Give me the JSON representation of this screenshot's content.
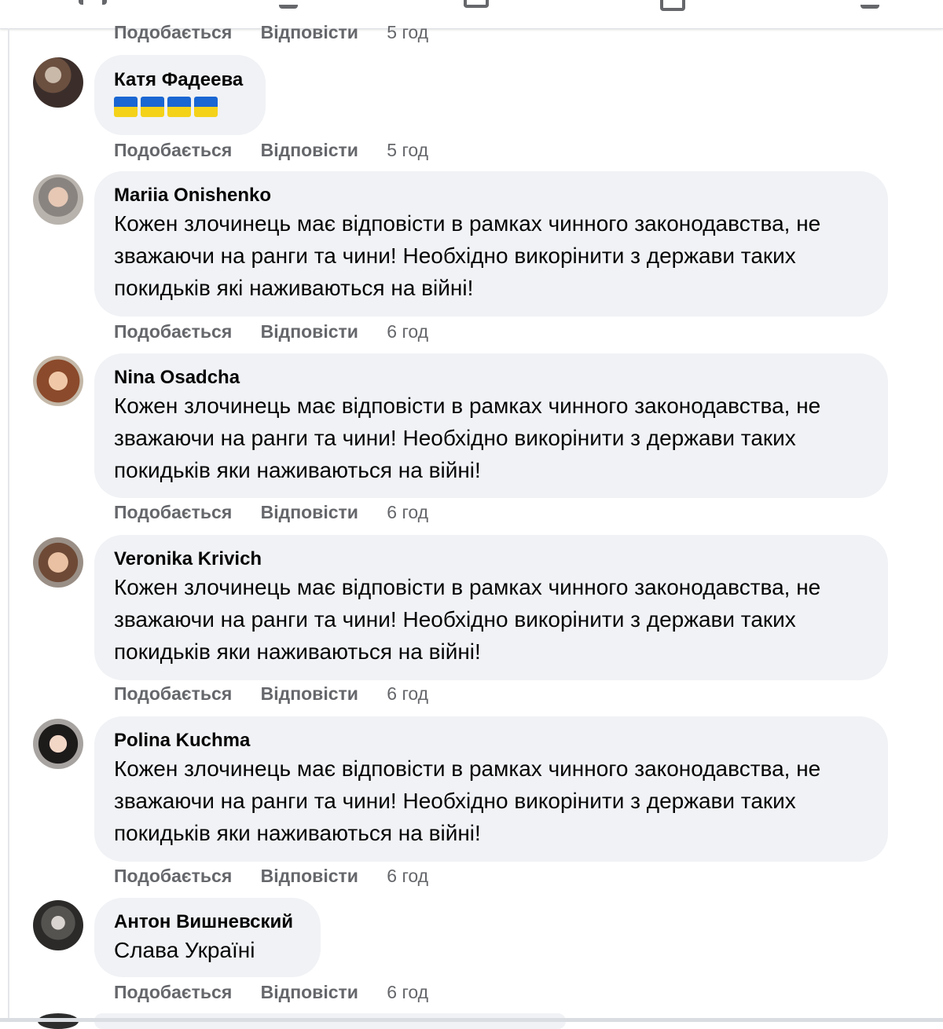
{
  "top_actions": {
    "like": "Подобається",
    "reply": "Відповісти",
    "time": "5 год"
  },
  "colors": {
    "flag_blue": "#1a66d2",
    "flag_yellow": "#f4d21a"
  },
  "comments": [
    {
      "author": "Катя Фадеева",
      "text": "",
      "flags": [
        "ukraine-flag-icon",
        "ukraine-flag-icon",
        "ukraine-flag-icon",
        "ukraine-flag-icon"
      ],
      "like": "Подобається",
      "reply": "Відповісти",
      "time": "5 год",
      "avatar": "avatar-photo"
    },
    {
      "author": "Mariia Onishenko",
      "text": "Кожен злочинець має відповісти в рамках чинного законодавства, не зважаючи на ранги та чини! Необхідно викорінити з держави таких покидьків які наживаються на війні!",
      "like": "Подобається",
      "reply": "Відповісти",
      "time": "6 год",
      "avatar": "avatar-photo"
    },
    {
      "author": "Nina Osadcha",
      "text": "Кожен злочинець має відповісти в рамках чинного законодавства, не зважаючи на ранги та чини! Необхідно викорінити з держави таких покидьків яки наживаються на війні!",
      "like": "Подобається",
      "reply": "Відповісти",
      "time": "6 год",
      "avatar": "avatar-photo"
    },
    {
      "author": "Veronika Krivich",
      "text": "Кожен злочинець має відповісти в рамках чинного законодавства, не зважаючи на ранги та чини! Необхідно викорінити з держави таких покидьків яки наживаються на війні!",
      "like": "Подобається",
      "reply": "Відповісти",
      "time": "6 год",
      "avatar": "avatar-photo"
    },
    {
      "author": "Polina Kuchma",
      "text": "Кожен злочинець має відповісти в рамках чинного законодавства, не зважаючи на ранги та чини! Необхідно викорінити з держави таких покидьків яки наживаються на війні!",
      "like": "Подобається",
      "reply": "Відповісти",
      "time": "6 год",
      "avatar": "avatar-photo"
    },
    {
      "author": "Антон Вишневский",
      "text": "Слава Україні",
      "like": "Подобається",
      "reply": "Відповісти",
      "time": "6 год",
      "avatar": "avatar-photo"
    }
  ]
}
